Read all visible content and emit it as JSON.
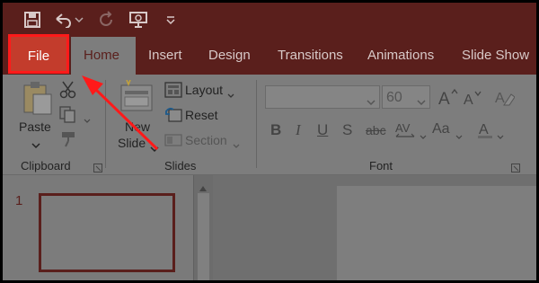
{
  "tabs": {
    "file": "File",
    "home": "Home",
    "insert": "Insert",
    "design": "Design",
    "transitions": "Transitions",
    "animations": "Animations",
    "slideshow": "Slide Show"
  },
  "clipboard": {
    "paste_label": "Paste",
    "group_label": "Clipboard"
  },
  "slides": {
    "new_slide_line1": "New",
    "new_slide_line2": "Slide",
    "layout_label": "Layout",
    "reset_label": "Reset",
    "section_label": "Section",
    "group_label": "Slides"
  },
  "font": {
    "font_name_value": "",
    "font_size_value": "60",
    "group_label": "Font"
  },
  "thumbnails": {
    "slide_number": "1"
  },
  "colors": {
    "brand": "#5a1f1c",
    "file_highlight": "#c33c2c",
    "annotation_red": "#ff1a1a"
  }
}
